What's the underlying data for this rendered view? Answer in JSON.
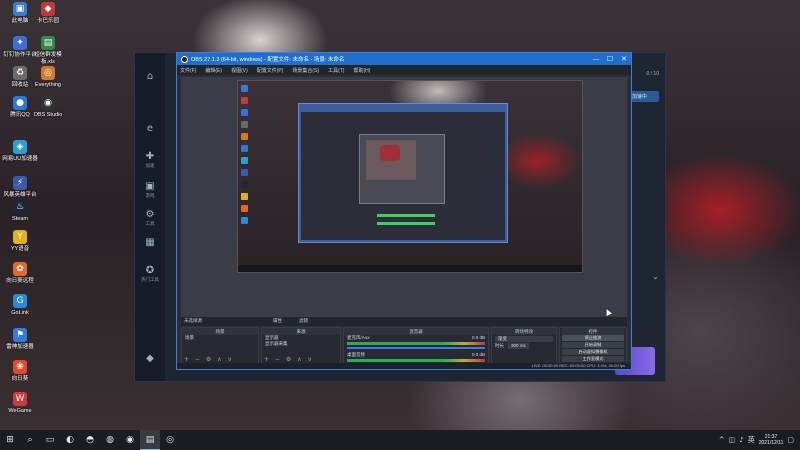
{
  "desktop": {
    "icons": [
      {
        "label": "此电脑",
        "glyph": "▣",
        "color": "#3a7ad0"
      },
      {
        "label": "卡巴乐园",
        "glyph": "◆",
        "color": "#c03a3a"
      },
      {
        "label": "钉钉协作平台",
        "glyph": "✦",
        "color": "#3a6fd8"
      },
      {
        "label": "短信群发模板.xls",
        "glyph": "▤",
        "color": "#2e8a4a"
      },
      {
        "label": "回收站",
        "glyph": "♻",
        "color": "#6a6a6a"
      },
      {
        "label": "Everything",
        "glyph": "◎",
        "color": "#d07a2a"
      },
      {
        "label": "腾讯QQ",
        "glyph": "●",
        "color": "#2a7ad8"
      },
      {
        "label": "OBS Studio",
        "glyph": "◉",
        "color": "#333333"
      },
      {
        "label": "网易UU加速器",
        "glyph": "◈",
        "color": "#2aa0d0"
      },
      {
        "label": "风暴英雄平台",
        "glyph": "⚡",
        "color": "#3a5ab0"
      },
      {
        "label": "Steam",
        "glyph": "♨",
        "color": "#1b2838"
      },
      {
        "label": "YY语音",
        "glyph": "Y",
        "color": "#e0b020"
      },
      {
        "label": "向日葵远程",
        "glyph": "✿",
        "color": "#e06a2a"
      },
      {
        "label": "GoLink",
        "glyph": "G",
        "color": "#2a8ad8"
      },
      {
        "label": "雷神加速器",
        "glyph": "⚑",
        "color": "#3a7ad8"
      },
      {
        "label": "向日葵",
        "glyph": "❀",
        "color": "#e04a2a"
      },
      {
        "label": "WeGame",
        "glyph": "W",
        "color": "#d03a3a"
      }
    ]
  },
  "launcher": {
    "sidebar": [
      {
        "glyph": "⌂",
        "label": ""
      },
      {
        "glyph": "e",
        "label": ""
      },
      {
        "glyph": "✚",
        "label": "加速"
      },
      {
        "glyph": "▣",
        "label": "游戏"
      },
      {
        "glyph": "⚙",
        "label": "工具"
      },
      {
        "glyph": "▦",
        "label": ""
      },
      {
        "glyph": "✪",
        "label": "热门工具"
      },
      {
        "glyph": "◆",
        "label": ""
      }
    ],
    "top_right_text": "0 / 10",
    "right_button": "加速中",
    "chevron": "⌄"
  },
  "obs": {
    "title": "OBS 27.1.3 (64-bit, windows) - 配置文件: 未命名 - 场景: 未命名",
    "window_controls": {
      "minimize": "—",
      "maximize": "☐",
      "close": "✕"
    },
    "menu": [
      "文件(F)",
      "编辑(E)",
      "视图(V)",
      "配置文件(P)",
      "场景集合(S)",
      "工具(T)",
      "帮助(H)"
    ],
    "panels": {
      "scenes": {
        "header": "场景",
        "items": [
          "场景"
        ]
      },
      "sources": {
        "header": "来源",
        "items": [
          "显示器",
          "显示器采集"
        ],
        "toolbar": "+ − ⚙ ∧ ∨"
      },
      "mixer": {
        "header": "混音器",
        "tracks": [
          {
            "name": "麦克风/Aux",
            "db": "0.0 dB"
          },
          {
            "name": "桌面音频",
            "db": "0.0 dB"
          }
        ]
      },
      "transitions": {
        "header": "转场特效",
        "type": "渐变",
        "duration_label": "时长",
        "duration": "300 ms"
      },
      "controls": {
        "header": "控件",
        "buttons": [
          "停止推流",
          "开始录制",
          "启动虚拟摄像机",
          "工作室模式",
          "设置",
          "退出"
        ]
      }
    },
    "scene_toolbar": {
      "label": "未选择源",
      "props": "属性",
      "filters": "滤镜"
    },
    "status": "LIVE: 00:00:00   REC: 00:00:00   CPU: 3.4%, 30.00 fps"
  },
  "taskbar": {
    "start": "⊞",
    "apps": [
      "⌕",
      "▭",
      "◐",
      "◓",
      "◍",
      "◉",
      "▤",
      "◎"
    ],
    "tray": {
      "up_arrow": "^",
      "network": "◫",
      "volume": "♪",
      "ime": "英",
      "notify": "▢"
    },
    "time": "21:37",
    "date": "2021/12/11"
  }
}
